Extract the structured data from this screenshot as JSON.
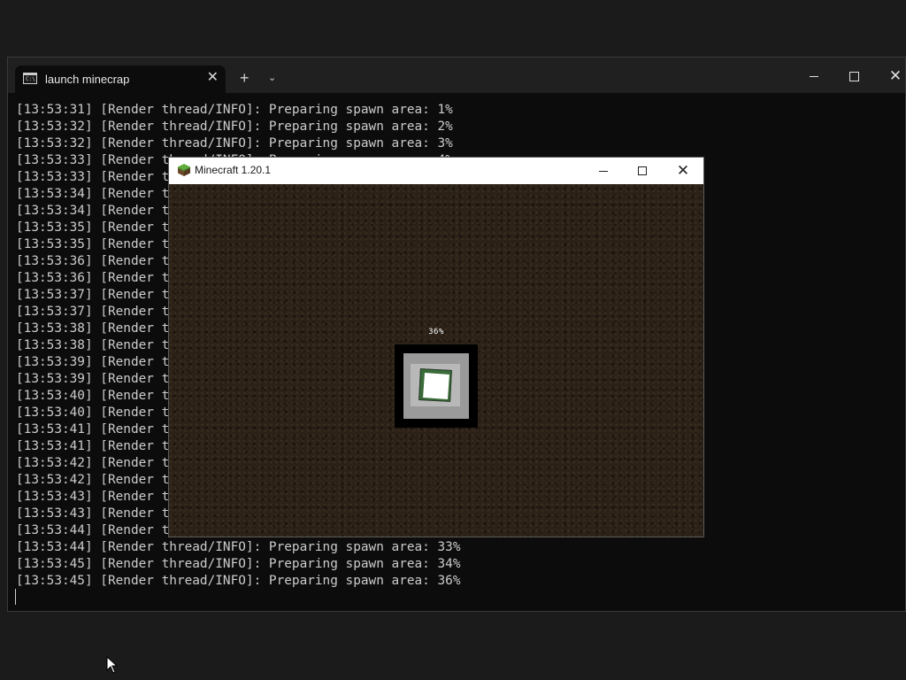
{
  "terminal": {
    "tab_title": "launch minecrap",
    "tab_icon_text": "C:\\",
    "new_tab_glyph": "+",
    "dropdown_glyph": "⌄",
    "close_glyph": "✕",
    "lines": [
      "[13:53:31] [Render thread/INFO]: Preparing spawn area: 1%",
      "[13:53:32] [Render thread/INFO]: Preparing spawn area: 2%",
      "[13:53:32] [Render thread/INFO]: Preparing spawn area: 3%",
      "[13:53:33] [Render thread/INFO]: Preparing spawn area: 4%",
      "[13:53:33] [Render t",
      "[13:53:34] [Render t",
      "[13:53:34] [Render t",
      "[13:53:35] [Render t",
      "[13:53:35] [Render t",
      "[13:53:36] [Render t",
      "[13:53:36] [Render t",
      "[13:53:37] [Render t",
      "[13:53:37] [Render t",
      "[13:53:38] [Render t",
      "[13:53:38] [Render t",
      "[13:53:39] [Render t",
      "[13:53:39] [Render t",
      "[13:53:40] [Render t",
      "[13:53:40] [Render t",
      "[13:53:41] [Render t",
      "[13:53:41] [Render t",
      "[13:53:42] [Render t",
      "[13:53:42] [Render t",
      "[13:53:43] [Render t",
      "[13:53:43] [Render t",
      "[13:53:44] [Render t",
      "[13:53:44] [Render thread/INFO]: Preparing spawn area: 33%",
      "[13:53:45] [Render thread/INFO]: Preparing spawn area: 34%",
      "[13:53:45] [Render thread/INFO]: Preparing spawn area: 36%"
    ]
  },
  "minecraft": {
    "window_title": "Minecraft 1.20.1",
    "progress_text": "36%",
    "progress_value": 36,
    "close_glyph": "✕"
  },
  "colors": {
    "terminal_bg": "#0c0c0c",
    "terminal_text": "#cccccc",
    "titlebar_bg": "#202020",
    "mc_titlebar_bg": "#ffffff",
    "dirt_bg": "#2b2117"
  },
  "icons": {
    "terminal_tab": "cmd-icon",
    "minecraft": "grass-block-icon",
    "mouse": "mouse-pointer-icon"
  }
}
